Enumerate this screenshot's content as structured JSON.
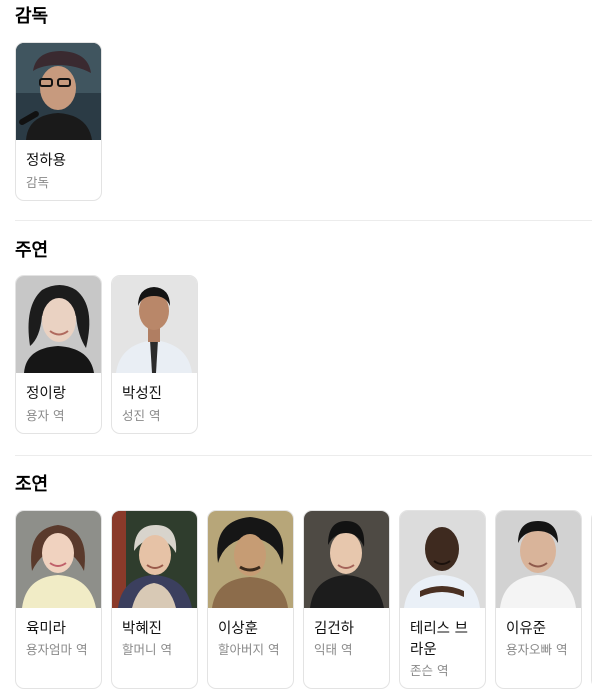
{
  "sections": [
    {
      "title": "감독",
      "people": [
        {
          "name": "정하용",
          "role": "감독"
        }
      ]
    },
    {
      "title": "주연",
      "people": [
        {
          "name": "정이랑",
          "role": "용자 역"
        },
        {
          "name": "박성진",
          "role": "성진 역"
        }
      ]
    },
    {
      "title": "조연",
      "people": [
        {
          "name": "육미라",
          "role": "용자엄마 역"
        },
        {
          "name": "박혜진",
          "role": "할머니 역"
        },
        {
          "name": "이상훈",
          "role": "할아버지 역"
        },
        {
          "name": "김건하",
          "role": "익태 역"
        },
        {
          "name": "테리스 브라운",
          "role": "존슨 역"
        },
        {
          "name": "이유준",
          "role": "용자오빠 역"
        }
      ]
    }
  ]
}
